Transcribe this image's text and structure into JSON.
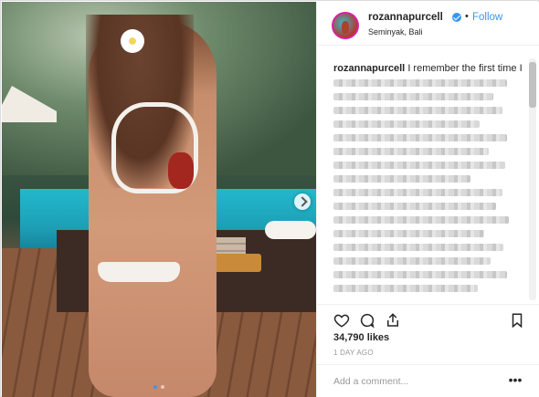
{
  "post": {
    "username": "rozannapurcell",
    "follow_label": "Follow",
    "separator": "•",
    "location": "Seminyak, Bali",
    "caption_user": "rozannapurcell",
    "caption_text": "I remember the first time I",
    "likes": "34,790 likes",
    "time": "1 DAY AGO",
    "comment_placeholder": "Add a comment...",
    "more_label": "•••",
    "carousel": {
      "total": 2,
      "active": 1
    }
  },
  "icons": {
    "verified": "verified-badge-icon",
    "heart": "heart-icon",
    "comment": "comment-icon",
    "share": "share-icon",
    "save": "bookmark-icon",
    "next": "chevron-right-icon",
    "more": "more-options-icon"
  },
  "colors": {
    "accent": "#3897f0",
    "text": "#262626",
    "muted": "#999999",
    "border": "#efefef"
  }
}
